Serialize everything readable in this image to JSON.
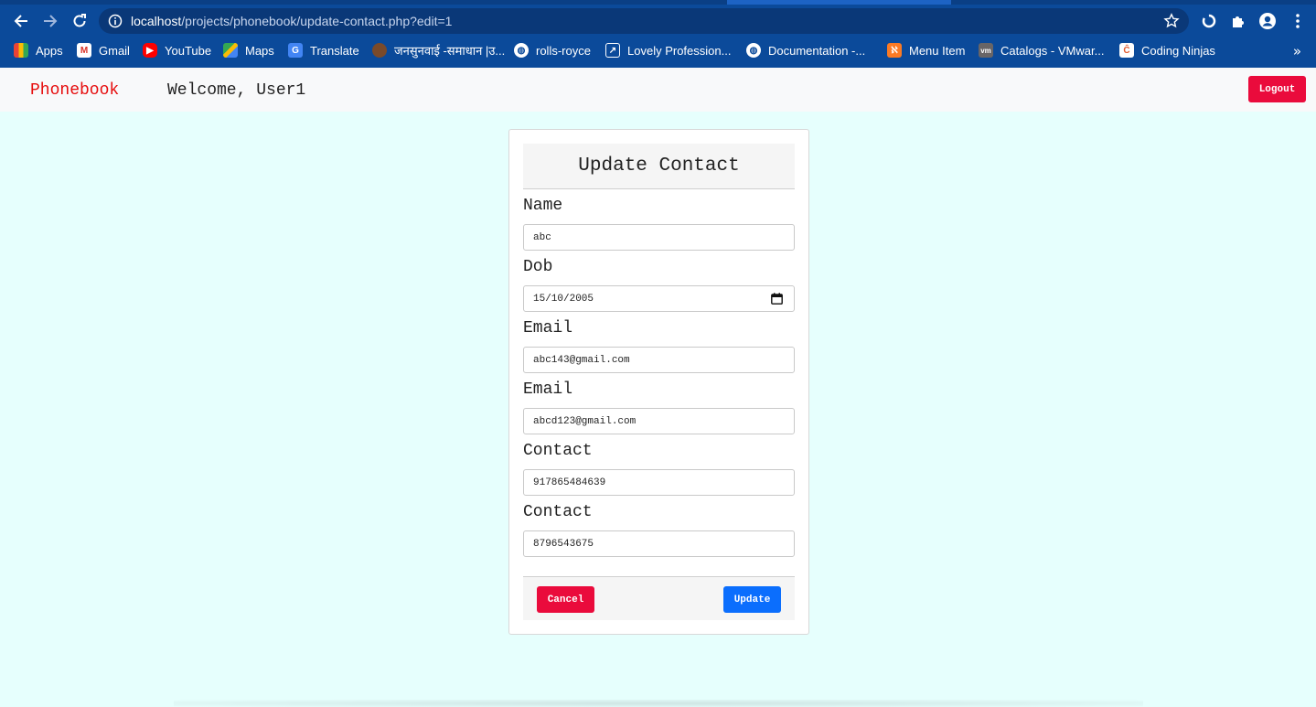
{
  "browser": {
    "url_host": "localhost",
    "url_path": "/projects/phonebook/update-contact.php?edit=1",
    "bookmarks": [
      {
        "label": "Apps",
        "icon": "apps-grid-icon",
        "color": "#f4b400"
      },
      {
        "label": "Gmail",
        "icon": "gmail-icon",
        "color": "#d93025"
      },
      {
        "label": "YouTube",
        "icon": "youtube-icon",
        "color": "#ff0000"
      },
      {
        "label": "Maps",
        "icon": "maps-icon",
        "color": "#34a853"
      },
      {
        "label": "Translate",
        "icon": "translate-icon",
        "color": "#4285f4"
      },
      {
        "label": "जनसुनवाई -समाधान |उ...",
        "icon": "emblem-icon",
        "color": "#7a4a2a"
      },
      {
        "label": "rolls-royce",
        "icon": "globe-icon",
        "color": "#ffffff"
      },
      {
        "label": "Lovely Profession...",
        "icon": "external-link-icon",
        "color": "#ffffff"
      },
      {
        "label": "Documentation -...",
        "icon": "globe-icon",
        "color": "#ffffff"
      },
      {
        "label": "Menu Item",
        "icon": "xampp-icon",
        "color": "#fb7a24"
      },
      {
        "label": "Catalogs - VMwar...",
        "icon": "vmware-icon",
        "color": "#696566"
      },
      {
        "label": "Coding Ninjas",
        "icon": "coding-ninjas-icon",
        "color": "#ffffff"
      }
    ],
    "more_label": "»"
  },
  "navbar": {
    "brand": "Phonebook",
    "welcome": "Welcome, User1",
    "logout_label": "Logout"
  },
  "form": {
    "title": "Update Contact",
    "fields": [
      {
        "label": "Name",
        "value": "abc"
      },
      {
        "label": "Dob",
        "value": "15/10/2005"
      },
      {
        "label": "Email",
        "value": "abc143@gmail.com"
      },
      {
        "label": "Email",
        "value": "abcd123@gmail.com"
      },
      {
        "label": "Contact",
        "value": "917865484639"
      },
      {
        "label": "Contact",
        "value": "8796543675"
      }
    ],
    "cancel_label": "Cancel",
    "update_label": "Update"
  },
  "colors": {
    "brand_red": "#e60c0c",
    "danger": "#ea0b3c",
    "primary": "#0b6efd",
    "page_bg": "#e6fffd",
    "chrome_bg": "#0b4a9a"
  }
}
